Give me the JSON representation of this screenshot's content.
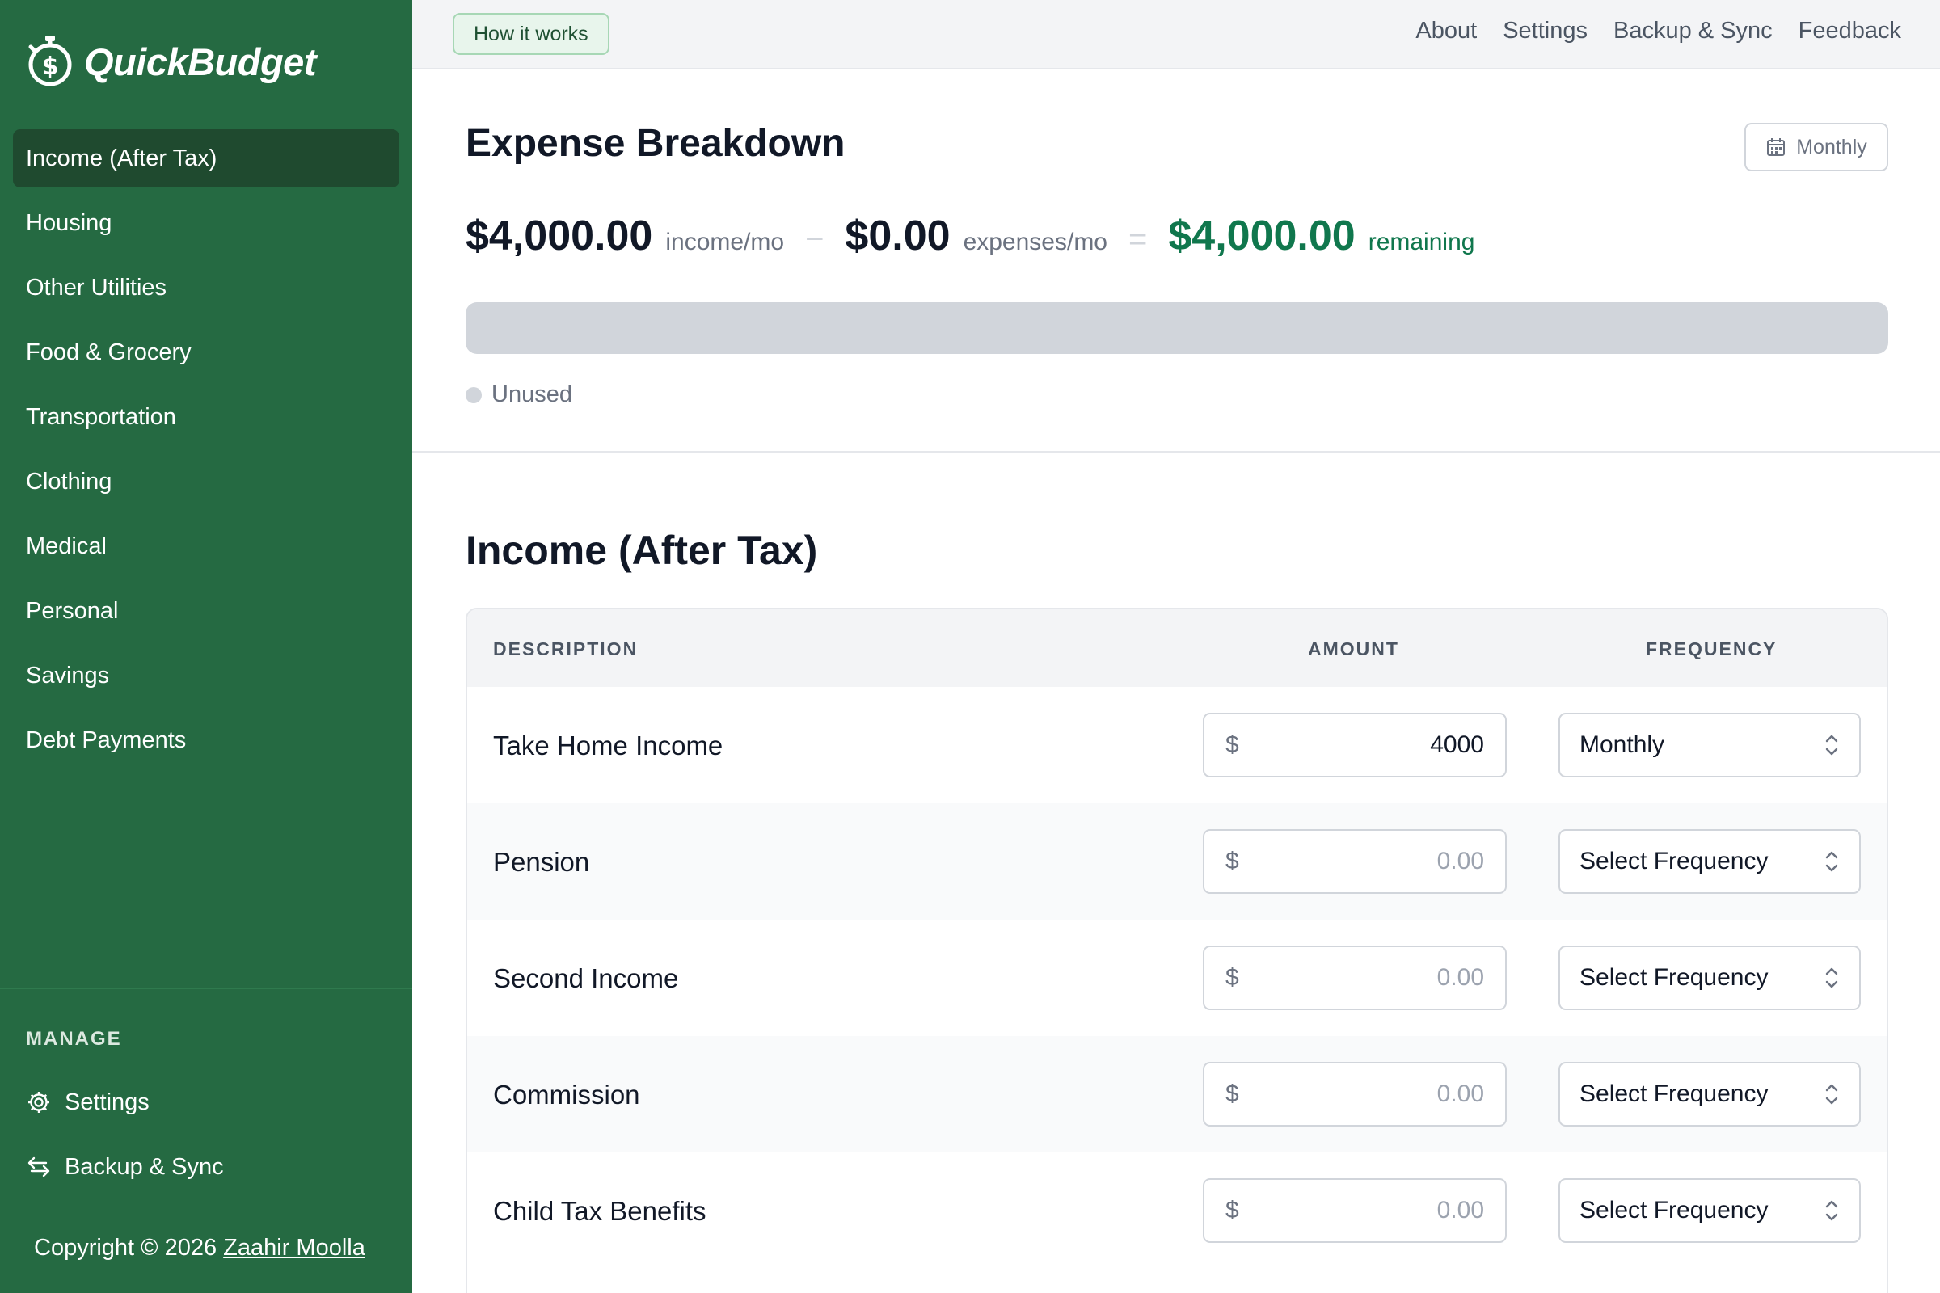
{
  "app": {
    "name": "QuickBudget"
  },
  "sidebar": {
    "items": [
      {
        "label": "Income (After Tax)",
        "active": true
      },
      {
        "label": "Housing"
      },
      {
        "label": "Other Utilities"
      },
      {
        "label": "Food & Grocery"
      },
      {
        "label": "Transportation"
      },
      {
        "label": "Clothing"
      },
      {
        "label": "Medical"
      },
      {
        "label": "Personal"
      },
      {
        "label": "Savings"
      },
      {
        "label": "Debt Payments"
      }
    ],
    "manage_label": "MANAGE",
    "manage_items": [
      {
        "label": "Settings",
        "icon": "gear-icon"
      },
      {
        "label": "Backup & Sync",
        "icon": "sync-arrows-icon"
      }
    ],
    "copyright_prefix": "Copyright © 2026",
    "copyright_author": "Zaahir Moolla"
  },
  "topbar": {
    "how_it_works": "How it works",
    "links": [
      "About",
      "Settings",
      "Backup & Sync",
      "Feedback"
    ]
  },
  "breakdown": {
    "title": "Expense Breakdown",
    "period": "Monthly",
    "income_amount": "$4,000.00",
    "income_unit": "income/mo",
    "minus_sign": "−",
    "expenses_amount": "$0.00",
    "expenses_unit": "expenses/mo",
    "equals_sign": "=",
    "remaining_amount": "$4,000.00",
    "remaining_unit": "remaining",
    "used_fraction": 0,
    "legend_label": "Unused",
    "colors": {
      "remaining": "#10774d",
      "unused": "#d1d5db"
    }
  },
  "income": {
    "title": "Income (After Tax)",
    "columns": {
      "description": "DESCRIPTION",
      "amount": "AMOUNT",
      "frequency": "FREQUENCY"
    },
    "currency_symbol": "$",
    "amount_placeholder": "0.00",
    "rows": [
      {
        "description": "Take Home Income",
        "amount": "4000",
        "frequency": "Monthly"
      },
      {
        "description": "Pension",
        "amount": "",
        "frequency": "Select Frequency"
      },
      {
        "description": "Second Income",
        "amount": "",
        "frequency": "Select Frequency"
      },
      {
        "description": "Commission",
        "amount": "",
        "frequency": "Select Frequency"
      },
      {
        "description": "Child Tax Benefits",
        "amount": "",
        "frequency": "Select Frequency"
      }
    ]
  },
  "theme": {
    "sidebar_bg": "#256a42",
    "sidebar_active": "#1f4a2f",
    "accent": "#10774d"
  }
}
